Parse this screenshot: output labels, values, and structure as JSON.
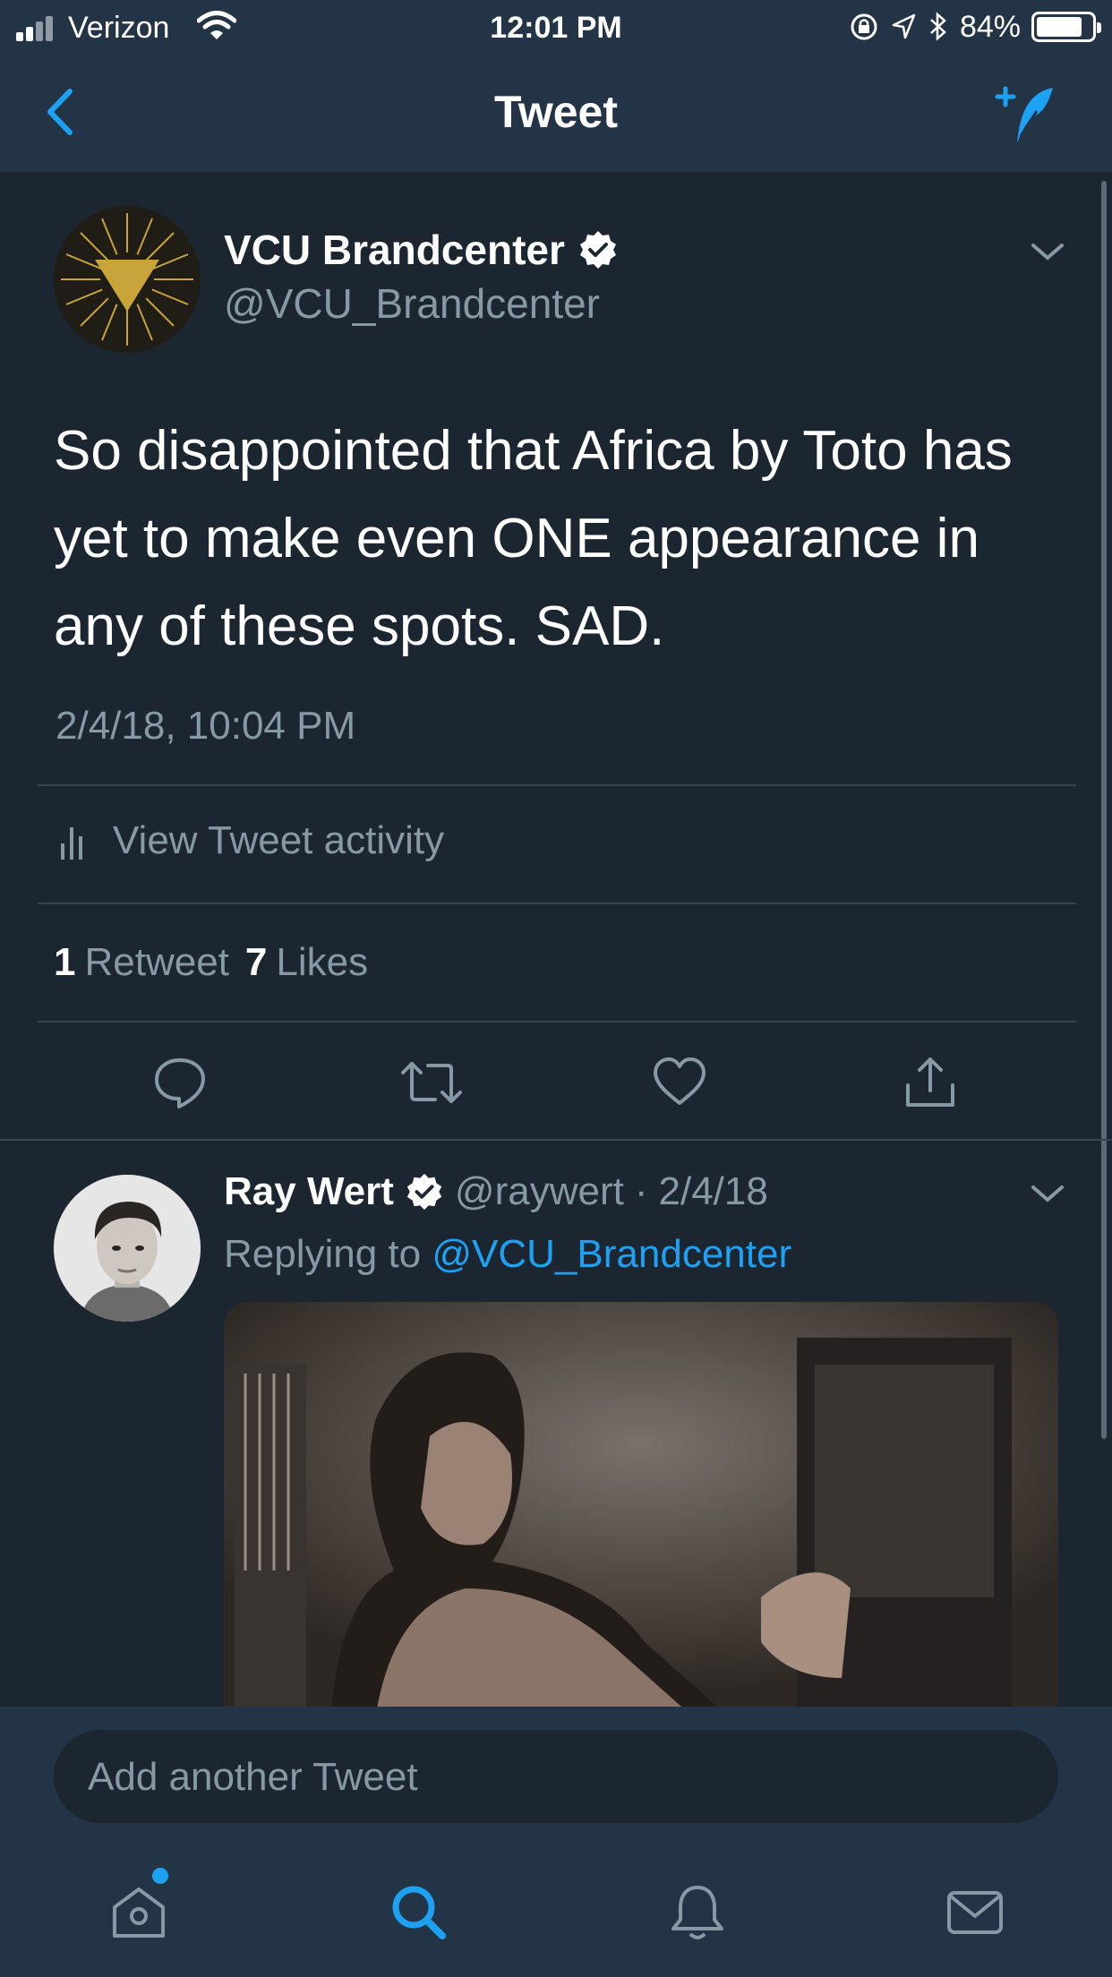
{
  "status_bar": {
    "carrier": "Verizon",
    "time": "12:01 PM",
    "battery_text": "84%",
    "battery_level": 0.84
  },
  "nav": {
    "title": "Tweet",
    "icons": [
      "back-chevron-icon",
      "compose-tweet-icon"
    ]
  },
  "tweet": {
    "author_name": "VCU Brandcenter",
    "author_handle": "@VCU_Brandcenter",
    "text": "So disappointed that Africa by Toto has yet to make even ONE appearance in any of these spots. SAD.",
    "timestamp": "2/4/18, 10:04 PM",
    "activity_label": "View Tweet activity",
    "retweet_count": "1",
    "retweet_label": "Retweet",
    "like_count": "7",
    "like_label": "Likes"
  },
  "reply": {
    "author_name": "Ray Wert",
    "author_handle": "@raywert",
    "separator": "·",
    "date": "2/4/18",
    "replying_prefix": "Replying to",
    "replying_handle": "@VCU_Brandcenter"
  },
  "composer": {
    "placeholder": "Add another Tweet"
  },
  "tab_bar": {
    "icons": [
      "home-icon",
      "search-icon",
      "notifications-icon",
      "messages-icon"
    ]
  },
  "colors": {
    "accent": "#1da1f2",
    "background": "#1c2631",
    "header": "#243447",
    "muted_text": "#8899a6",
    "gold": "#c9a43a"
  }
}
